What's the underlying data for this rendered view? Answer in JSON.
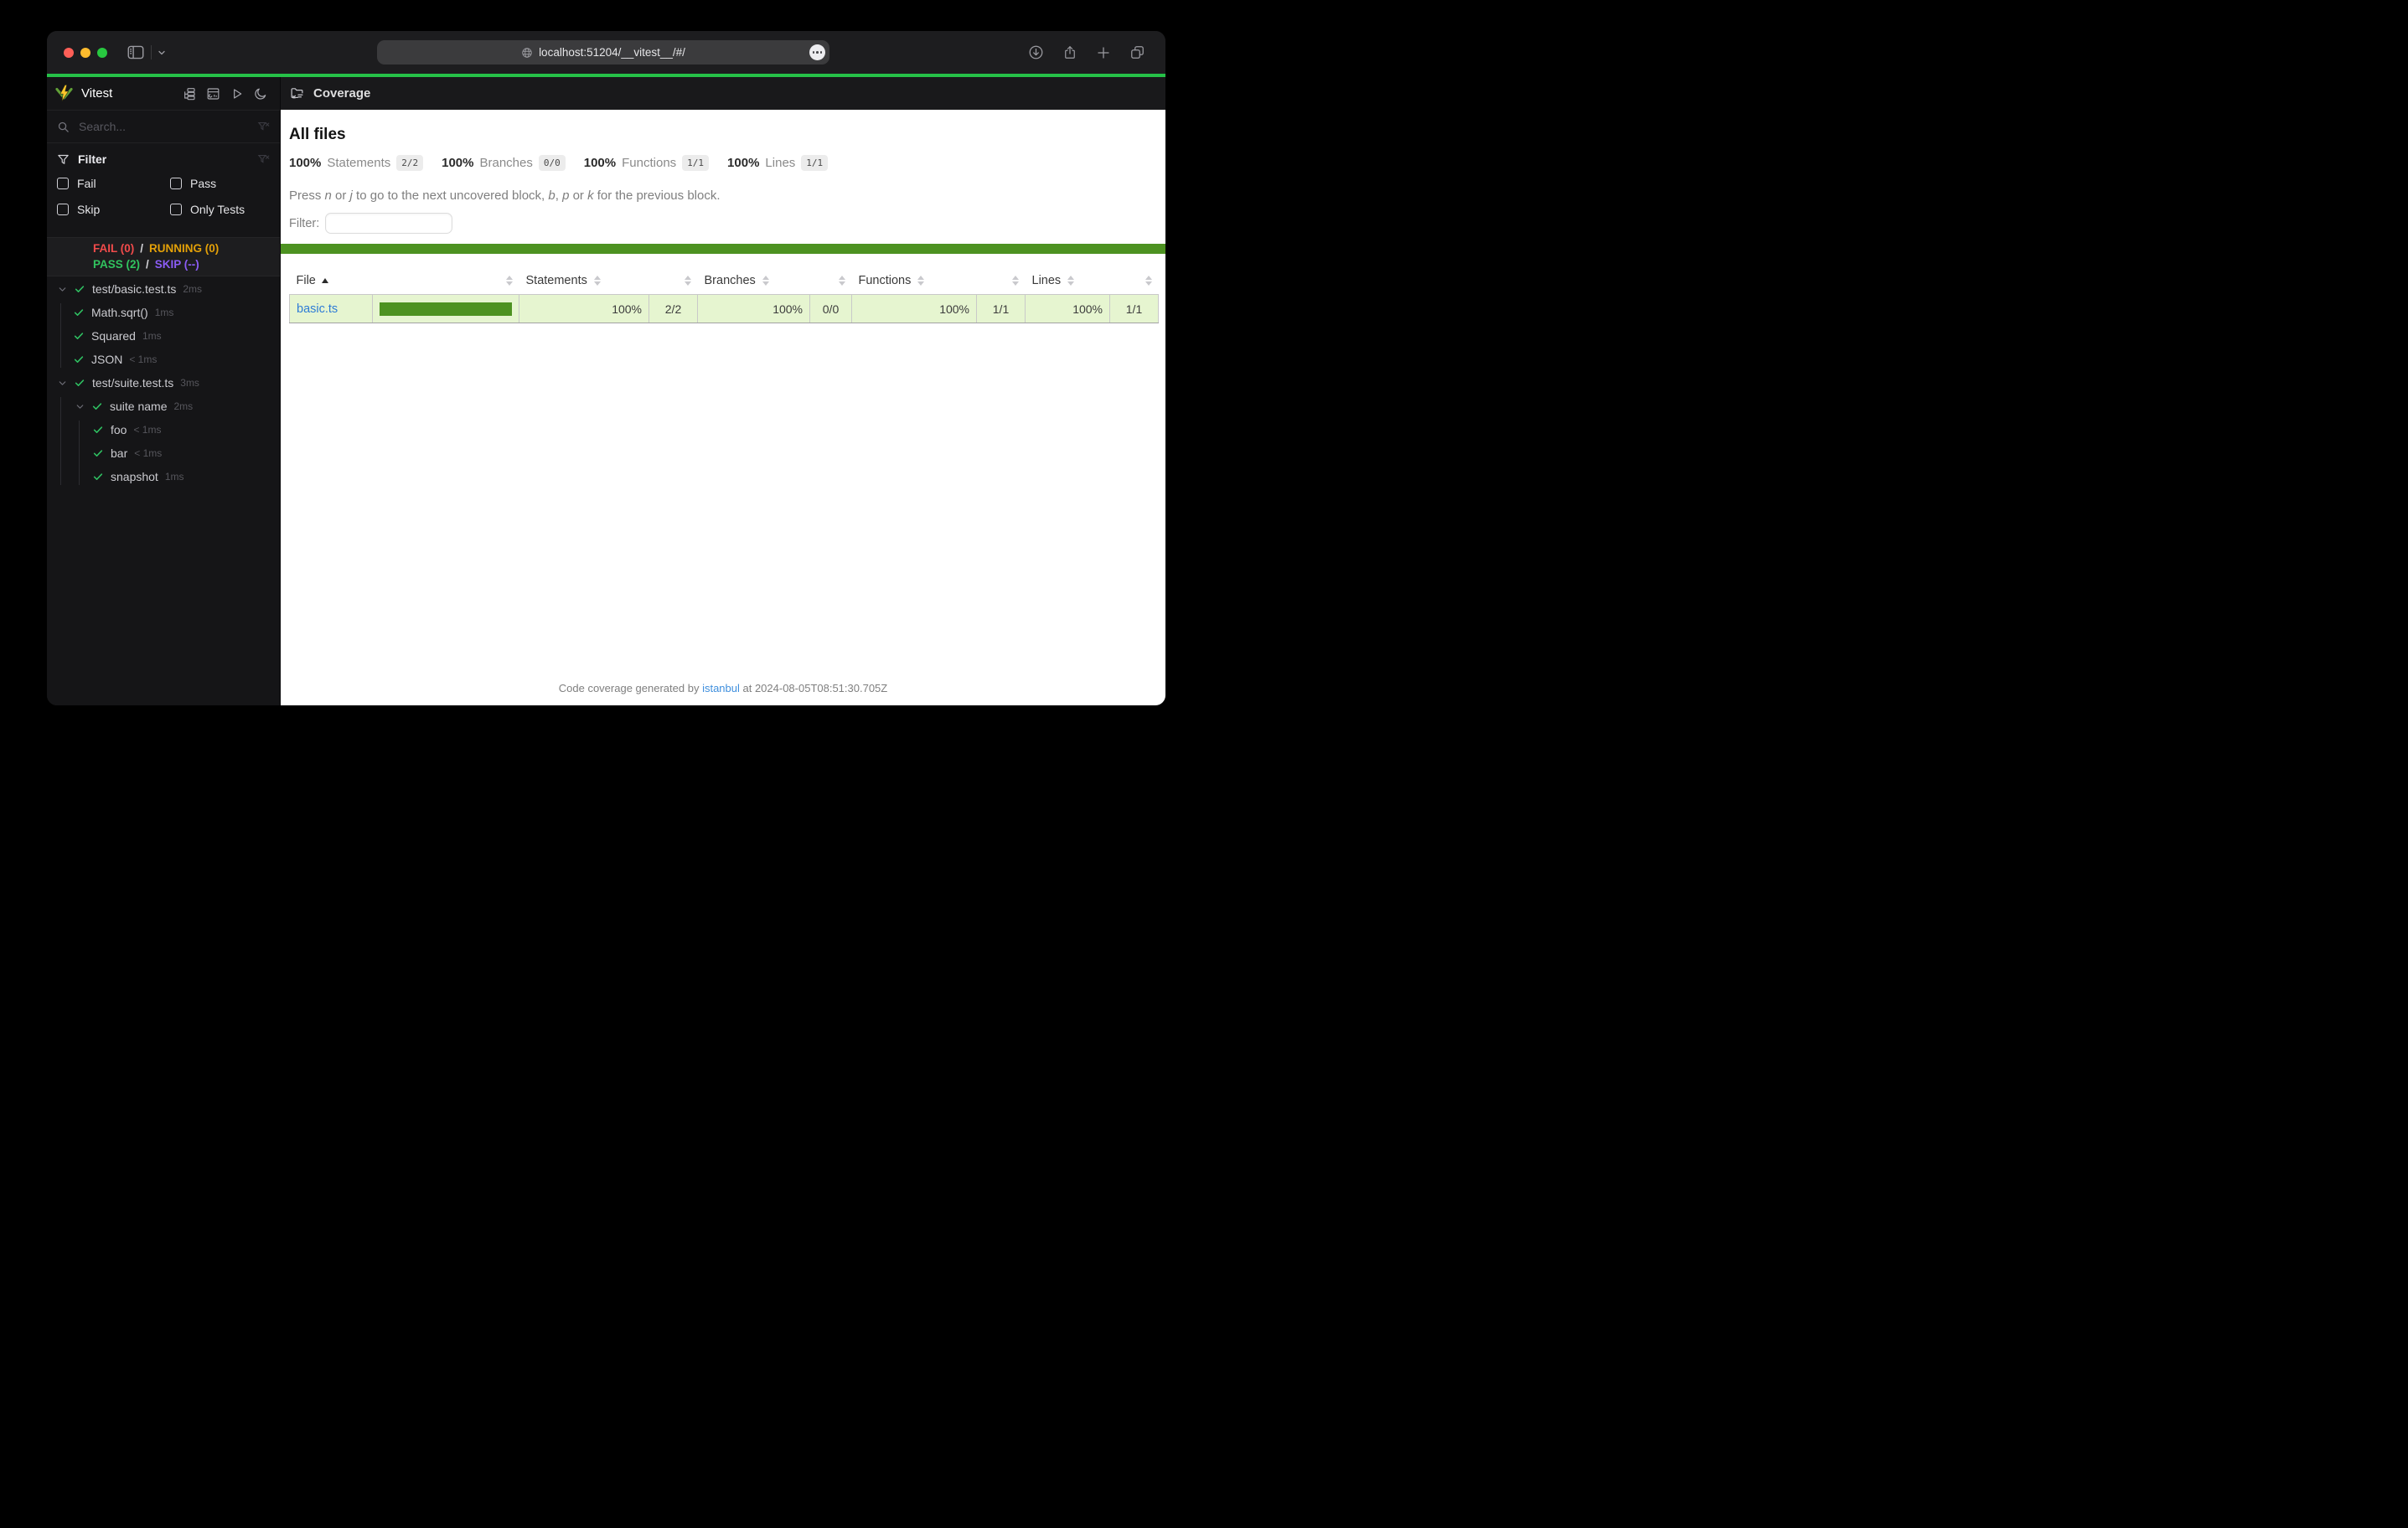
{
  "browser": {
    "url": "localhost:51204/__vitest__/#/"
  },
  "sidebar": {
    "title": "Vitest",
    "search_placeholder": "Search...",
    "filter": {
      "label": "Filter",
      "options": [
        "Fail",
        "Pass",
        "Skip",
        "Only Tests"
      ]
    },
    "status": {
      "lines": [
        [
          {
            "text": "FAIL (0)",
            "type": "fail"
          },
          {
            "text": "/",
            "type": "sep"
          },
          {
            "text": "RUNNING (0)",
            "type": "running"
          }
        ],
        [
          {
            "text": "PASS (2)",
            "type": "pass"
          },
          {
            "text": "/",
            "type": "sep"
          },
          {
            "text": "SKIP (--)",
            "type": "skip"
          }
        ]
      ]
    },
    "tree": [
      {
        "level": 0,
        "chevron": true,
        "label": "test/basic.test.ts",
        "time": "2ms"
      },
      {
        "level": 1,
        "chevron": false,
        "label": "Math.sqrt()",
        "time": "1ms"
      },
      {
        "level": 1,
        "chevron": false,
        "label": "Squared",
        "time": "1ms"
      },
      {
        "level": 1,
        "chevron": false,
        "label": "JSON",
        "time": "< 1ms"
      },
      {
        "level": 0,
        "chevron": true,
        "label": "test/suite.test.ts",
        "time": "3ms"
      },
      {
        "level": 1,
        "chevron": true,
        "label": "suite name",
        "time": "2ms"
      },
      {
        "level": 2,
        "chevron": false,
        "label": "foo",
        "time": "< 1ms"
      },
      {
        "level": 2,
        "chevron": false,
        "label": "bar",
        "time": "< 1ms"
      },
      {
        "level": 2,
        "chevron": false,
        "label": "snapshot",
        "time": "1ms"
      }
    ]
  },
  "main": {
    "header_title": "Coverage",
    "heading": "All files",
    "summary": [
      {
        "pct": "100%",
        "label": "Statements",
        "frac": "2/2"
      },
      {
        "pct": "100%",
        "label": "Branches",
        "frac": "0/0"
      },
      {
        "pct": "100%",
        "label": "Functions",
        "frac": "1/1"
      },
      {
        "pct": "100%",
        "label": "Lines",
        "frac": "1/1"
      }
    ],
    "hint_segments": [
      {
        "t": "Press "
      },
      {
        "t": "n",
        "i": 1
      },
      {
        "t": " or "
      },
      {
        "t": "j",
        "i": 1
      },
      {
        "t": " to go to the next uncovered block, "
      },
      {
        "t": "b",
        "i": 1
      },
      {
        "t": ", "
      },
      {
        "t": "p",
        "i": 1
      },
      {
        "t": " or "
      },
      {
        "t": "k",
        "i": 1
      },
      {
        "t": " for the previous block."
      }
    ],
    "filter_label": "Filter:",
    "table": {
      "header": [
        {
          "kind": "file",
          "label": "File",
          "sorted": "asc"
        },
        {
          "kind": "bar"
        },
        {
          "kind": "pct",
          "label": "Statements"
        },
        {
          "kind": "frac"
        },
        {
          "kind": "pct",
          "label": "Branches"
        },
        {
          "kind": "frac"
        },
        {
          "kind": "pct",
          "label": "Functions"
        },
        {
          "kind": "frac"
        },
        {
          "kind": "pct",
          "label": "Lines"
        },
        {
          "kind": "frac"
        }
      ],
      "rows": [
        {
          "file": "basic.ts",
          "bar_pct": 100,
          "cells": [
            "100%",
            "2/2",
            "100%",
            "0/0",
            "100%",
            "1/1",
            "100%",
            "1/1"
          ]
        }
      ]
    },
    "footer": {
      "prefix": "Code coverage generated by ",
      "link_text": "istanbul",
      "suffix": " at 2024-08-05T08:51:30.705Z"
    }
  },
  "colors": {
    "accent_green": "#26c148",
    "coverage_green": "#4d9221",
    "coverage_row_bg": "#e6f5d0",
    "fail": "#f24b4b",
    "running": "#e3a008",
    "pass": "#31c45f",
    "skip": "#8b5cf6",
    "check": "#2fc162",
    "link": "#2e7cd6"
  }
}
